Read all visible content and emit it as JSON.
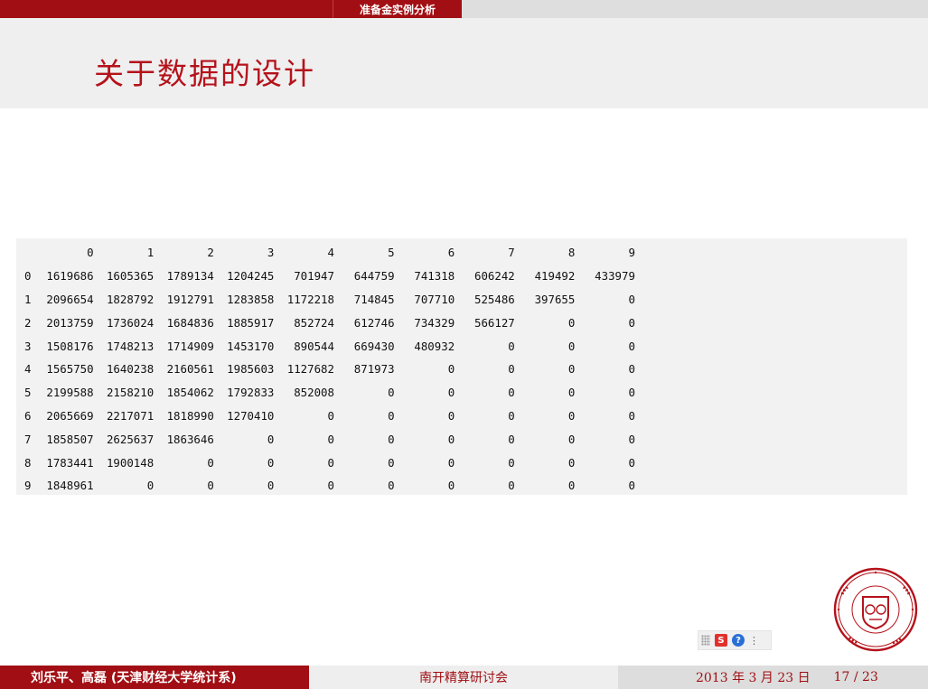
{
  "nav": {
    "current_section": "准备金实例分析"
  },
  "slide": {
    "title": "关于数据的设计"
  },
  "table": {
    "columns": [
      "0",
      "1",
      "2",
      "3",
      "4",
      "5",
      "6",
      "7",
      "8",
      "9"
    ],
    "rows": [
      {
        "index": "0",
        "cells": [
          "1619686",
          "1605365",
          "1789134",
          "1204245",
          "701947",
          "644759",
          "741318",
          "606242",
          "419492",
          "433979"
        ]
      },
      {
        "index": "1",
        "cells": [
          "2096654",
          "1828792",
          "1912791",
          "1283858",
          "1172218",
          "714845",
          "707710",
          "525486",
          "397655",
          "0"
        ]
      },
      {
        "index": "2",
        "cells": [
          "2013759",
          "1736024",
          "1684836",
          "1885917",
          "852724",
          "612746",
          "734329",
          "566127",
          "0",
          "0"
        ]
      },
      {
        "index": "3",
        "cells": [
          "1508176",
          "1748213",
          "1714909",
          "1453170",
          "890544",
          "669430",
          "480932",
          "0",
          "0",
          "0"
        ]
      },
      {
        "index": "4",
        "cells": [
          "1565750",
          "1640238",
          "2160561",
          "1985603",
          "1127682",
          "871973",
          "0",
          "0",
          "0",
          "0"
        ]
      },
      {
        "index": "5",
        "cells": [
          "2199588",
          "2158210",
          "1854062",
          "1792833",
          "852008",
          "0",
          "0",
          "0",
          "0",
          "0"
        ]
      },
      {
        "index": "6",
        "cells": [
          "2065669",
          "2217071",
          "1818990",
          "1270410",
          "0",
          "0",
          "0",
          "0",
          "0",
          "0"
        ]
      },
      {
        "index": "7",
        "cells": [
          "1858507",
          "2625637",
          "1863646",
          "0",
          "0",
          "0",
          "0",
          "0",
          "0",
          "0"
        ]
      },
      {
        "index": "8",
        "cells": [
          "1783441",
          "1900148",
          "0",
          "0",
          "0",
          "0",
          "0",
          "0",
          "0",
          "0"
        ]
      },
      {
        "index": "9",
        "cells": [
          "1848961",
          "0",
          "0",
          "0",
          "0",
          "0",
          "0",
          "0",
          "0",
          "0"
        ]
      }
    ]
  },
  "toolbar": {
    "s_label": "S",
    "help_label": "?",
    "more_label": "⋮"
  },
  "footer": {
    "author": "刘乐平、高磊 (天津财经大学统计系)",
    "event": "南开精算研讨会",
    "date": "2013 年 3 月 23 日",
    "page": "17 / 23"
  },
  "icons": {
    "logo": "university-seal-icon",
    "grip": "grip-icon",
    "s": "sogou-s-icon",
    "help": "help-icon",
    "more": "more-icon"
  },
  "colors": {
    "accent": "#a10f14",
    "title": "#b5121b",
    "band": "#efefef",
    "table_bg": "#f2f2f2"
  }
}
